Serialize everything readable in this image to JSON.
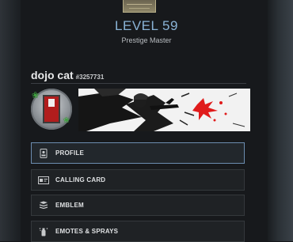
{
  "header": {
    "level_text": "LEVEL 59",
    "prestige_text": "Prestige Master"
  },
  "player": {
    "name": "dojo cat",
    "id": "#3257731"
  },
  "menu": {
    "items": [
      {
        "label": "PROFILE",
        "icon": "profile-icon",
        "active": true
      },
      {
        "label": "CALLING CARD",
        "icon": "calling-card-icon",
        "active": false
      },
      {
        "label": "EMBLEM",
        "icon": "emblem-icon",
        "active": false
      },
      {
        "label": "EMOTES & SPRAYS",
        "icon": "emotes-sprays-icon",
        "active": false
      }
    ]
  },
  "colors": {
    "level_blue": "#8ab3d6",
    "active_border": "#6c8db0",
    "emblem_red": "#b11d1d",
    "card_splash_red": "#e01b1b"
  }
}
